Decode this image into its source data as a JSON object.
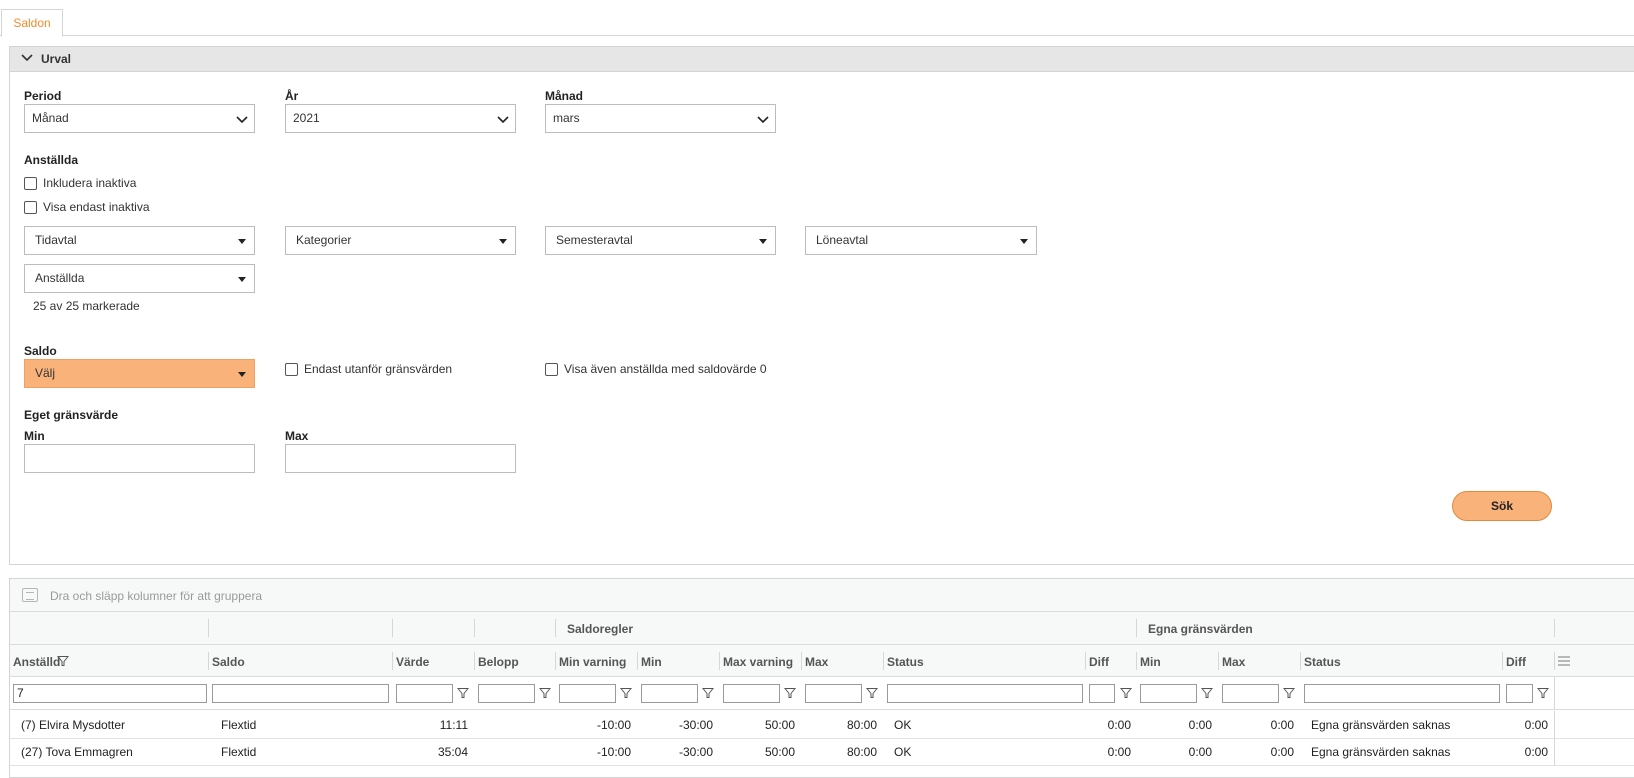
{
  "tabs": [
    {
      "label": "Saldon"
    }
  ],
  "urval": {
    "title": "Urval",
    "period_label": "Period",
    "period_value": "Månad",
    "ar_label": "År",
    "ar_value": "2021",
    "manad_label": "Månad",
    "manad_value": "mars",
    "anstallda_label": "Anställda",
    "inkludera_inaktiva": "Inkludera inaktiva",
    "visa_endast_inaktiva": "Visa endast inaktiva",
    "tidavtal": "Tidavtal",
    "kategorier": "Kategorier",
    "semesteravtal": "Semesteravtal",
    "loneavtal": "Löneavtal",
    "anstallda_dropdown": "Anställda",
    "markerade": "25 av 25 markerade",
    "saldo_label": "Saldo",
    "saldo_value": "Välj",
    "endast_utanfor": "Endast utanför gränsvärden",
    "visa_aven": "Visa även anställda med saldovärde 0",
    "eget_gransvarde": "Eget gränsvärde",
    "min_label": "Min",
    "max_label": "Max",
    "sok": "Sök"
  },
  "grid": {
    "group_hint": "Dra och släpp kolumner för att gruppera",
    "group_headers": {
      "saldoregler": "Saldoregler",
      "egna": "Egna gränsvärden"
    },
    "columns": [
      "Anställd",
      "Saldo",
      "Värde",
      "Belopp",
      "Min varning",
      "Min",
      "Max varning",
      "Max",
      "Status",
      "Diff",
      "Min",
      "Max",
      "Status",
      "Diff"
    ],
    "filter_anstalld": "7",
    "rows": [
      {
        "anstalld": "(7) Elvira Mysdotter",
        "saldo": "Flextid",
        "varde": "11:11",
        "belopp": "",
        "min_varning": "-10:00",
        "min": "-30:00",
        "max_varning": "50:00",
        "max": "80:00",
        "status": "OK",
        "diff": "0:00",
        "e_min": "0:00",
        "e_max": "0:00",
        "e_status": "Egna gränsvärden saknas",
        "e_diff": "0:00"
      },
      {
        "anstalld": "(27) Tova Emmagren",
        "saldo": "Flextid",
        "varde": "35:04",
        "belopp": "",
        "min_varning": "-10:00",
        "min": "-30:00",
        "max_varning": "50:00",
        "max": "80:00",
        "status": "OK",
        "diff": "0:00",
        "e_min": "0:00",
        "e_max": "0:00",
        "e_status": "Egna gränsvärden saknas",
        "e_diff": "0:00"
      }
    ]
  },
  "icons": {
    "collapse": "chevron-down-icon",
    "group": "group-panel-icon",
    "filter": "filter-icon",
    "column_menu": "column-menu-icon"
  },
  "colors": {
    "accent": "#f08c2a",
    "button_fill": "#f9b27a"
  }
}
